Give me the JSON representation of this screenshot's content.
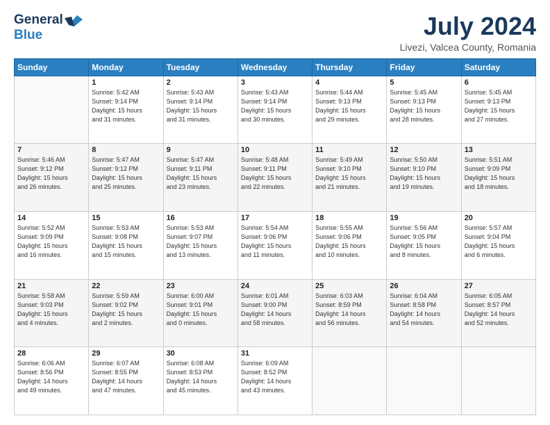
{
  "header": {
    "logo_general": "General",
    "logo_blue": "Blue",
    "month_year": "July 2024",
    "location": "Livezi, Valcea County, Romania"
  },
  "weekdays": [
    "Sunday",
    "Monday",
    "Tuesday",
    "Wednesday",
    "Thursday",
    "Friday",
    "Saturday"
  ],
  "weeks": [
    [
      {
        "day": "",
        "info": ""
      },
      {
        "day": "1",
        "info": "Sunrise: 5:42 AM\nSunset: 9:14 PM\nDaylight: 15 hours\nand 31 minutes."
      },
      {
        "day": "2",
        "info": "Sunrise: 5:43 AM\nSunset: 9:14 PM\nDaylight: 15 hours\nand 31 minutes."
      },
      {
        "day": "3",
        "info": "Sunrise: 5:43 AM\nSunset: 9:14 PM\nDaylight: 15 hours\nand 30 minutes."
      },
      {
        "day": "4",
        "info": "Sunrise: 5:44 AM\nSunset: 9:13 PM\nDaylight: 15 hours\nand 29 minutes."
      },
      {
        "day": "5",
        "info": "Sunrise: 5:45 AM\nSunset: 9:13 PM\nDaylight: 15 hours\nand 28 minutes."
      },
      {
        "day": "6",
        "info": "Sunrise: 5:45 AM\nSunset: 9:13 PM\nDaylight: 15 hours\nand 27 minutes."
      }
    ],
    [
      {
        "day": "7",
        "info": "Sunrise: 5:46 AM\nSunset: 9:12 PM\nDaylight: 15 hours\nand 26 minutes."
      },
      {
        "day": "8",
        "info": "Sunrise: 5:47 AM\nSunset: 9:12 PM\nDaylight: 15 hours\nand 25 minutes."
      },
      {
        "day": "9",
        "info": "Sunrise: 5:47 AM\nSunset: 9:11 PM\nDaylight: 15 hours\nand 23 minutes."
      },
      {
        "day": "10",
        "info": "Sunrise: 5:48 AM\nSunset: 9:11 PM\nDaylight: 15 hours\nand 22 minutes."
      },
      {
        "day": "11",
        "info": "Sunrise: 5:49 AM\nSunset: 9:10 PM\nDaylight: 15 hours\nand 21 minutes."
      },
      {
        "day": "12",
        "info": "Sunrise: 5:50 AM\nSunset: 9:10 PM\nDaylight: 15 hours\nand 19 minutes."
      },
      {
        "day": "13",
        "info": "Sunrise: 5:51 AM\nSunset: 9:09 PM\nDaylight: 15 hours\nand 18 minutes."
      }
    ],
    [
      {
        "day": "14",
        "info": "Sunrise: 5:52 AM\nSunset: 9:09 PM\nDaylight: 15 hours\nand 16 minutes."
      },
      {
        "day": "15",
        "info": "Sunrise: 5:53 AM\nSunset: 9:08 PM\nDaylight: 15 hours\nand 15 minutes."
      },
      {
        "day": "16",
        "info": "Sunrise: 5:53 AM\nSunset: 9:07 PM\nDaylight: 15 hours\nand 13 minutes."
      },
      {
        "day": "17",
        "info": "Sunrise: 5:54 AM\nSunset: 9:06 PM\nDaylight: 15 hours\nand 11 minutes."
      },
      {
        "day": "18",
        "info": "Sunrise: 5:55 AM\nSunset: 9:06 PM\nDaylight: 15 hours\nand 10 minutes."
      },
      {
        "day": "19",
        "info": "Sunrise: 5:56 AM\nSunset: 9:05 PM\nDaylight: 15 hours\nand 8 minutes."
      },
      {
        "day": "20",
        "info": "Sunrise: 5:57 AM\nSunset: 9:04 PM\nDaylight: 15 hours\nand 6 minutes."
      }
    ],
    [
      {
        "day": "21",
        "info": "Sunrise: 5:58 AM\nSunset: 9:03 PM\nDaylight: 15 hours\nand 4 minutes."
      },
      {
        "day": "22",
        "info": "Sunrise: 5:59 AM\nSunset: 9:02 PM\nDaylight: 15 hours\nand 2 minutes."
      },
      {
        "day": "23",
        "info": "Sunrise: 6:00 AM\nSunset: 9:01 PM\nDaylight: 15 hours\nand 0 minutes."
      },
      {
        "day": "24",
        "info": "Sunrise: 6:01 AM\nSunset: 9:00 PM\nDaylight: 14 hours\nand 58 minutes."
      },
      {
        "day": "25",
        "info": "Sunrise: 6:03 AM\nSunset: 8:59 PM\nDaylight: 14 hours\nand 56 minutes."
      },
      {
        "day": "26",
        "info": "Sunrise: 6:04 AM\nSunset: 8:58 PM\nDaylight: 14 hours\nand 54 minutes."
      },
      {
        "day": "27",
        "info": "Sunrise: 6:05 AM\nSunset: 8:57 PM\nDaylight: 14 hours\nand 52 minutes."
      }
    ],
    [
      {
        "day": "28",
        "info": "Sunrise: 6:06 AM\nSunset: 8:56 PM\nDaylight: 14 hours\nand 49 minutes."
      },
      {
        "day": "29",
        "info": "Sunrise: 6:07 AM\nSunset: 8:55 PM\nDaylight: 14 hours\nand 47 minutes."
      },
      {
        "day": "30",
        "info": "Sunrise: 6:08 AM\nSunset: 8:53 PM\nDaylight: 14 hours\nand 45 minutes."
      },
      {
        "day": "31",
        "info": "Sunrise: 6:09 AM\nSunset: 8:52 PM\nDaylight: 14 hours\nand 43 minutes."
      },
      {
        "day": "",
        "info": ""
      },
      {
        "day": "",
        "info": ""
      },
      {
        "day": "",
        "info": ""
      }
    ]
  ]
}
